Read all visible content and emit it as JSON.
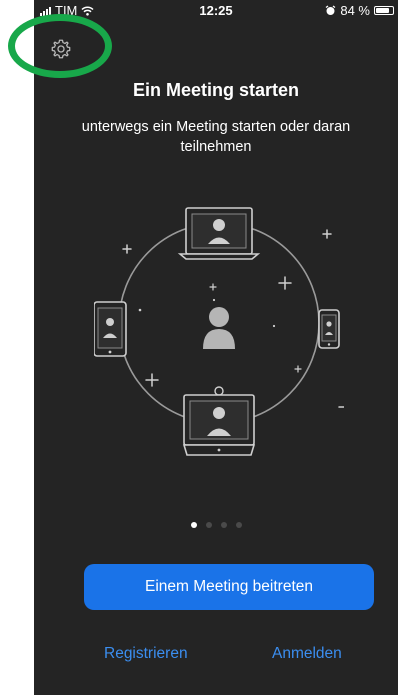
{
  "status_bar": {
    "carrier": "TIM",
    "time": "12:25",
    "battery": "84 %",
    "battery_level": 0.84
  },
  "header": {
    "settings_icon": "gear-icon"
  },
  "main": {
    "title": "Ein Meeting starten",
    "subtitle": "unterwegs ein Meeting starten oder daran teilnehmen"
  },
  "pager": {
    "total": 4,
    "active_index": 0
  },
  "actions": {
    "join_label": "Einem Meeting beitreten",
    "register_label": "Registrieren",
    "login_label": "Anmelden"
  },
  "colors": {
    "background": "#242424",
    "accent": "#1a73e8",
    "link": "#3b8ef0",
    "highlight": "#18a84a"
  }
}
